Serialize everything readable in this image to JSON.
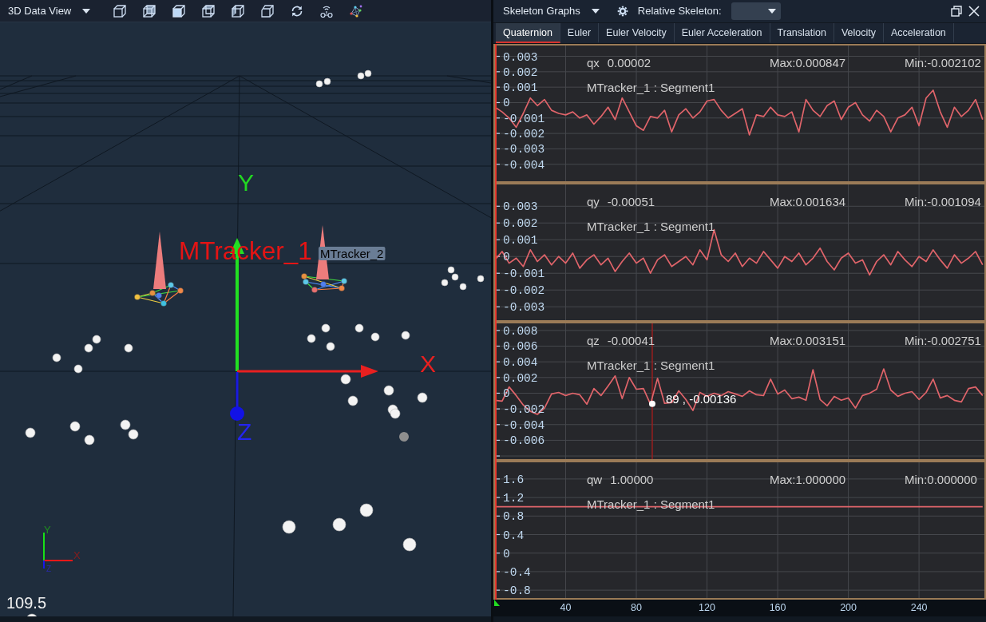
{
  "view_toolbar": {
    "title": "3D Data View"
  },
  "scene": {
    "axes": [
      {
        "kind": "y",
        "label": "Y"
      },
      {
        "kind": "x",
        "label": "X"
      },
      {
        "kind": "z",
        "label": "Z"
      }
    ],
    "rigid_bodies": [
      {
        "name": "MTracker_1",
        "selected": true
      },
      {
        "name": "MTracker_2",
        "selected": false
      }
    ],
    "gizmo_axes": [
      {
        "kind": "y",
        "label": "Y"
      },
      {
        "kind": "x",
        "label": "X"
      },
      {
        "kind": "z",
        "label": "Z"
      }
    ],
    "readout": "109.5"
  },
  "graphs_header": {
    "title": "Skeleton Graphs",
    "relative_skeleton_label": "Relative Skeleton:"
  },
  "tabs": [
    {
      "label": "Quaternion",
      "selected": true
    },
    {
      "label": "Euler",
      "selected": false
    },
    {
      "label": "Euler Velocity",
      "selected": false
    },
    {
      "label": "Euler Acceleration",
      "selected": false
    },
    {
      "label": "Translation",
      "selected": false
    },
    {
      "label": "Velocity",
      "selected": false
    },
    {
      "label": "Acceleration",
      "selected": false
    }
  ],
  "plots": [
    {
      "value": "0.00002",
      "max": "Max:0.000847",
      "min": "Min:-0.002102",
      "segment": "MTracker_1 : Segment1",
      "chart_data": {
        "type": "line",
        "x": [
          0,
          4,
          8,
          12,
          16,
          20,
          24,
          28,
          32,
          36,
          40,
          44,
          48,
          52,
          56,
          60,
          64,
          68,
          72,
          76,
          80,
          84,
          88,
          92,
          96,
          100,
          104,
          108,
          112,
          116,
          120,
          124,
          128,
          132,
          136,
          140,
          144,
          148,
          152,
          156,
          160,
          164,
          168,
          172,
          176,
          180,
          184,
          188,
          192,
          196,
          200,
          204,
          208,
          212,
          216,
          220,
          224,
          228,
          232,
          236,
          240,
          244,
          248,
          252,
          256,
          260,
          264,
          268,
          272,
          276
        ],
        "series": [
          {
            "name": "qx",
            "color": "#e0646a",
            "values": [
              -0.0003,
              -0.0006,
              -0.001,
              -0.0016,
              -0.0007,
              0.0003,
              -0.0002,
              0.0002,
              -0.0005,
              -0.0007,
              -0.0008,
              -0.0006,
              -0.001,
              -0.0008,
              -0.0014,
              -0.0009,
              -0.0003,
              -0.0011,
              0.0003,
              -0.0006,
              -0.0015,
              -0.0018,
              -0.0009,
              -0.001,
              -0.0005,
              -0.0019,
              -0.0008,
              -0.0004,
              -0.001,
              -0.0006,
              0.0001,
              0.0002,
              -0.0005,
              -0.001,
              -0.0007,
              -0.0004,
              -0.0021,
              -0.0008,
              -0.0009,
              -0.0003,
              -0.0008,
              -0.0009,
              -0.0006,
              -0.0019,
              0.0002,
              -0.0005,
              -0.0009,
              -0.0002,
              0.0001,
              -0.0011,
              -0.0003,
              0,
              -0.0008,
              -0.0012,
              -0.0005,
              -0.0009,
              -0.0019,
              -0.001,
              -0.0008,
              -0.0003,
              -0.0015,
              0.0003,
              0.0008,
              -0.0006,
              -0.0016,
              -0.0003,
              -0.0009,
              -0.0005,
              0.0002,
              -0.0011
            ]
          }
        ],
        "xlim": [
          0,
          277
        ],
        "ylim": [
          -0.0051,
          0.0037
        ],
        "yticks": [
          0.003,
          0.002,
          0.001,
          0,
          -0.001,
          -0.002,
          -0.003,
          -0.004
        ],
        "grid": true
      }
    },
    {
      "value": "-0.00051",
      "max": "Max:0.001634",
      "min": "Min:-0.001094",
      "segment": "MTracker_1 : Segment1",
      "chart_data": {
        "type": "line",
        "x": [
          0,
          4,
          8,
          12,
          16,
          20,
          24,
          28,
          32,
          36,
          40,
          44,
          48,
          52,
          56,
          60,
          64,
          68,
          72,
          76,
          80,
          84,
          88,
          92,
          96,
          100,
          104,
          108,
          112,
          116,
          120,
          124,
          128,
          132,
          136,
          140,
          144,
          148,
          152,
          156,
          160,
          164,
          168,
          172,
          176,
          180,
          184,
          188,
          192,
          196,
          200,
          204,
          208,
          212,
          216,
          220,
          224,
          228,
          232,
          236,
          240,
          244,
          248,
          252,
          256,
          260,
          264,
          268,
          272,
          276
        ],
        "series": [
          {
            "name": "qy",
            "color": "#e0646a",
            "values": [
              -0.0002,
              0.0003,
              -0.0004,
              -0.0001,
              -0.0006,
              0.0004,
              -0.0003,
              0.0001,
              -0.0005,
              0,
              -0.0004,
              0.0002,
              -0.0007,
              -0.0002,
              0.0001,
              -0.0005,
              -0.0001,
              -0.0009,
              -0.0003,
              0.0002,
              -0.0004,
              -0.0001,
              -0.001,
              -0.0002,
              0.0001,
              -0.0006,
              -0.0003,
              0,
              -0.0005,
              0.0004,
              -0.0002,
              0.0016,
              0.0001,
              -0.0003,
              0.0002,
              -0.0006,
              -0.0001,
              -0.0004,
              0.0003,
              -0.0002,
              -0.0007,
              0,
              -0.0003,
              0.0002,
              -0.0005,
              -0.0001,
              0.0005,
              -0.0003,
              -0.0008,
              -0.0001,
              0.0002,
              -0.0004,
              -0.0002,
              -0.0011,
              -0.0003,
              0.0001,
              -0.0005,
              0.0003,
              -0.0002,
              -0.0006,
              0,
              -0.0003,
              0.0004,
              -0.0002,
              -0.0007,
              0.0001,
              -0.0004,
              -0.0001,
              0.0003,
              -0.0005
            ]
          }
        ],
        "xlim": [
          0,
          277
        ],
        "ylim": [
          -0.0038,
          0.0043
        ],
        "yticks": [
          0.003,
          0.002,
          0.001,
          0,
          -0.001,
          -0.002,
          -0.003
        ],
        "grid": true
      }
    },
    {
      "value": "-0.00041",
      "max": "Max:0.003151",
      "min": "Min:-0.002751",
      "segment": "MTracker_1 : Segment1",
      "chart_data": {
        "type": "line",
        "x": [
          0,
          4,
          8,
          12,
          16,
          20,
          24,
          28,
          32,
          36,
          40,
          44,
          48,
          52,
          56,
          60,
          64,
          68,
          72,
          76,
          80,
          84,
          88,
          92,
          96,
          100,
          104,
          108,
          112,
          116,
          120,
          124,
          128,
          132,
          136,
          140,
          144,
          148,
          152,
          156,
          160,
          164,
          168,
          172,
          176,
          180,
          184,
          188,
          192,
          196,
          200,
          204,
          208,
          212,
          216,
          220,
          224,
          228,
          232,
          236,
          240,
          244,
          248,
          252,
          256,
          260,
          264,
          268,
          272,
          276
        ],
        "series": [
          {
            "name": "qz",
            "color": "#e0646a",
            "values": [
              -0.0009,
              -0.001,
              0.0008,
              -0.0003,
              -0.0015,
              -0.0023,
              -0.0027,
              -0.0019,
              -0.0001,
              0.0001,
              -0.0003,
              0,
              -0.0002,
              -0.0014,
              0.0006,
              -0.0003,
              0.0009,
              0.0022,
              -0.0007,
              0.002,
              0.0005,
              0.0006,
              -0.0014,
              0.0019,
              -0.0013,
              -0.0012,
              0.0003,
              -0.0008,
              -0.0022,
              0.0001,
              -0.0004,
              0,
              -0.0003,
              0.0002,
              -0.0001,
              -0.0004,
              0.0003,
              -0.0002,
              -0.0003,
              0.0018,
              -0.0001,
              0.0004,
              -0.0007,
              -0.0005,
              -0.0009,
              0.003,
              -0.0008,
              -0.0016,
              -0.0004,
              -0.0009,
              -0.0006,
              -0.0019,
              -0.0003,
              0,
              0.0005,
              0.0031,
              0.0004,
              -0.0004,
              0,
              0.0002,
              -0.0008,
              0.0001,
              0.0018,
              -0.0006,
              -0.0003,
              -0.0009,
              -0.0011,
              0.0006,
              0.0008,
              -0.0003
            ]
          }
        ],
        "xlim": [
          0,
          277
        ],
        "ylim": [
          -0.0084,
          0.0089
        ],
        "yticks": [
          0.008,
          0.006,
          0.004,
          0.002,
          0,
          -0.002,
          -0.004,
          -0.006
        ],
        "grid": true,
        "ref_lines": [
          {
            "axis": "x",
            "value": 89,
            "color": "#9a1f1f"
          }
        ],
        "annotations": [
          {
            "x": 89,
            "y": -0.00136,
            "text": "89 , -0.00136"
          }
        ]
      }
    },
    {
      "value": "1.00000",
      "max": "Max:1.000000",
      "min": "Min:0.000000",
      "segment": "MTracker_1 : Segment1",
      "chart_data": {
        "type": "line",
        "x": [
          0,
          276
        ],
        "series": [
          {
            "name": "qw",
            "color": "#e0646a",
            "values": [
              1,
              1
            ]
          }
        ],
        "xlim": [
          0,
          277
        ],
        "ylim": [
          -0.97,
          1.96
        ],
        "xticks": [
          40,
          80,
          120,
          160,
          200,
          240
        ],
        "yticks": [
          1.6,
          1.2,
          0.8,
          0.4,
          0,
          -0.4,
          -0.8
        ],
        "grid": true
      }
    }
  ]
}
